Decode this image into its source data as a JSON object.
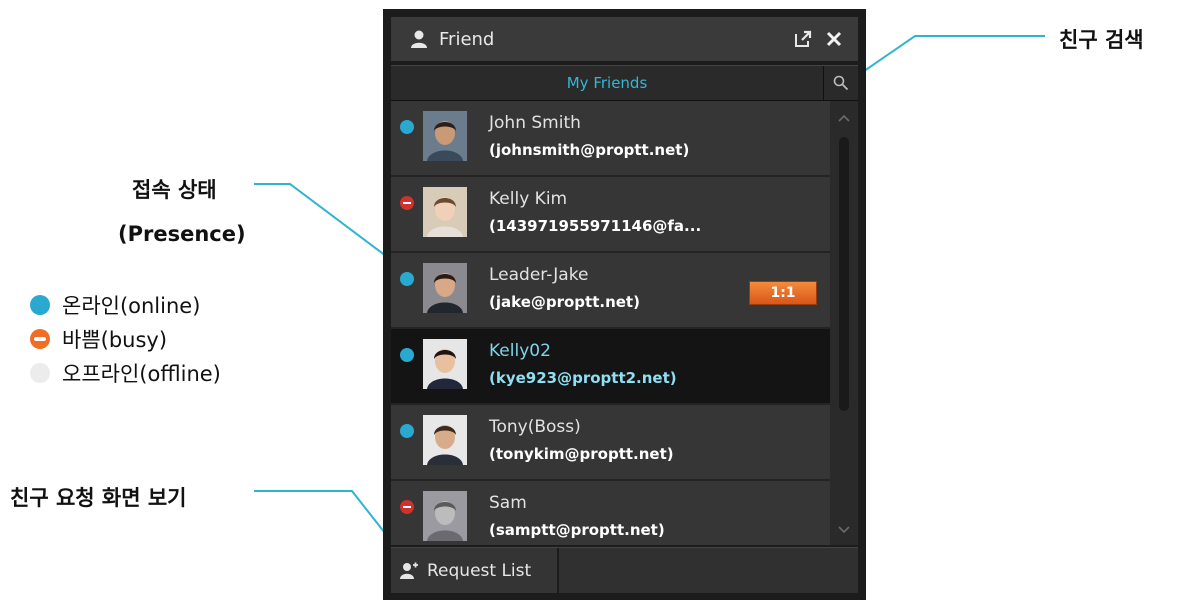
{
  "window": {
    "title": "Friend",
    "tab": "My Friends"
  },
  "friends": [
    {
      "name": "John Smith",
      "email": "(johnsmith@proptt.net)",
      "status": "online"
    },
    {
      "name": "Kelly Kim",
      "email": "(143971955971146@fa...",
      "status": "busy"
    },
    {
      "name": "Leader-Jake",
      "email": "(jake@proptt.net)",
      "status": "online",
      "badge": "1:1"
    },
    {
      "name": "Kelly02",
      "email": "(kye923@proptt2.net)",
      "status": "online",
      "selected": true
    },
    {
      "name": "Tony(Boss)",
      "email": "(tonykim@proptt.net)",
      "status": "online"
    },
    {
      "name": "Sam",
      "email": "(samptt@proptt.net)",
      "status": "busy"
    }
  ],
  "footer": {
    "request_list": "Request List"
  },
  "annotations": {
    "search": "친구 검색",
    "presence_line1": "접속 상태",
    "presence_line2": "(Presence)",
    "request": "친구 요청 화면 보기"
  },
  "legend": {
    "online": "온라인(online)",
    "busy": "바쁨(busy)",
    "offline": "오프라인(offline)"
  },
  "colors": {
    "online": "#29a9cf",
    "busy": "#f06e24",
    "offline": "#ececec",
    "accent": "#35b6d6",
    "annotation_line": "#2fb4d0"
  }
}
